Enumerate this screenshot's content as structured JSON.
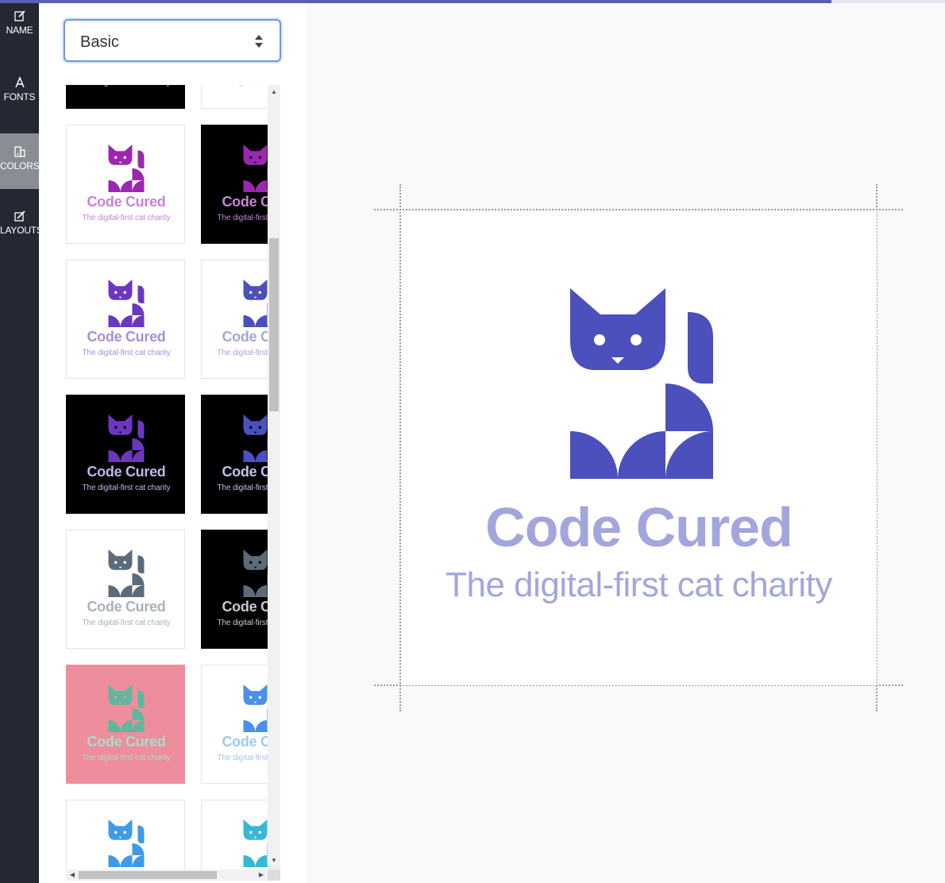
{
  "progress": {
    "fraction": 0.88,
    "fill_color": "#5a5fb8"
  },
  "nav": {
    "items": [
      {
        "label": "NAME",
        "icon": "edit-icon",
        "active": false
      },
      {
        "label": "FONTS",
        "icon": "font-icon",
        "active": false
      },
      {
        "label": "COLORS",
        "icon": "palette-icon",
        "active": true
      },
      {
        "label": "LAYOUTS",
        "icon": "layouts-icon",
        "active": false
      }
    ]
  },
  "palette_select": {
    "value": "Basic"
  },
  "brand": {
    "name": "Code Cured",
    "tagline": "The digital-first cat charity"
  },
  "palettes": [
    {
      "bg": "#000000",
      "icon": "#cccccc",
      "name": "#cccccc",
      "tag": "#cccccc"
    },
    {
      "bg": "#ffffff",
      "icon": "#f0c45c",
      "name": "#f0c45c",
      "tag": "#f0c45c"
    },
    {
      "bg": "#ffffff",
      "icon": "#9b27b0",
      "name": "#c584d6",
      "tag": "#c584d6"
    },
    {
      "bg": "#000000",
      "icon": "#9b27b0",
      "name": "#c584d6",
      "tag": "#c584d6"
    },
    {
      "bg": "#ffffff",
      "icon": "#6c37c0",
      "name": "#a88fd6",
      "tag": "#a88fd6"
    },
    {
      "bg": "#ffffff",
      "icon": "#4b50bd",
      "name": "#a3a6dc",
      "tag": "#a3a6dc"
    },
    {
      "bg": "#000000",
      "icon": "#6c37c0",
      "name": "#c4b4ec",
      "tag": "#c4b4ec"
    },
    {
      "bg": "#000000",
      "icon": "#4b50bd",
      "name": "#c0c2ee",
      "tag": "#c0c2ee"
    },
    {
      "bg": "#ffffff",
      "icon": "#5b6b7a",
      "name": "#a9b1ba",
      "tag": "#a9b1ba"
    },
    {
      "bg": "#000000",
      "icon": "#5b6b7a",
      "name": "#c4cbd2",
      "tag": "#c4cbd2"
    },
    {
      "bg": "#ee8d9c",
      "icon": "#5fb89e",
      "name": "#a9dcc8",
      "tag": "#a9dcc8"
    },
    {
      "bg": "#ffffff",
      "icon": "#4a8fef",
      "name": "#a1c6f6",
      "tag": "#a1c6f6"
    },
    {
      "bg": "#ffffff",
      "icon": "#3f9be6",
      "name": "#9ccaf2",
      "tag": "#9ccaf2"
    },
    {
      "bg": "#ffffff",
      "icon": "#38b8d6",
      "name": "#98d9e8",
      "tag": "#98d9e8"
    }
  ],
  "preview": {
    "icon": "#4b50bd",
    "name": "#a3a6dc",
    "tag": "#a3a6dc",
    "bg": "#ffffff"
  }
}
